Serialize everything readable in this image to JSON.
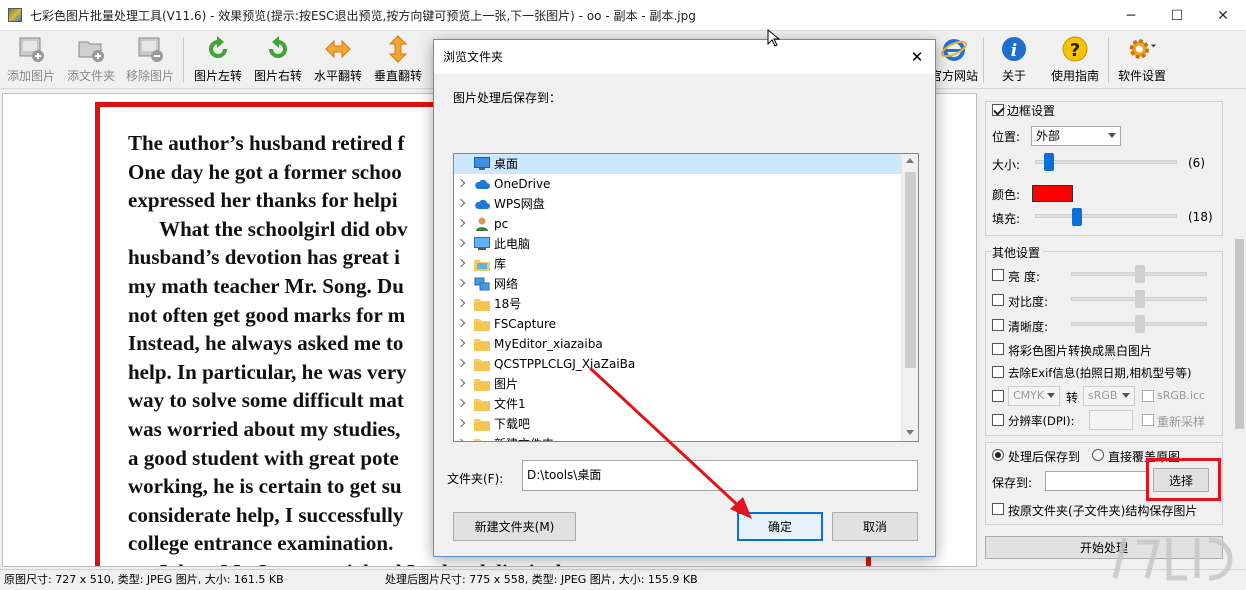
{
  "window": {
    "title": "七彩色图片批量处理工具(V11.6) - 效果预览(提示:按ESC退出预览,按方向键可预览上一张,下一张图片) - oo - 副本 - 副本.jpg",
    "minimize": "─",
    "maximize": "☐",
    "close": "✕"
  },
  "toolbar": {
    "add_image": "添加图片",
    "add_folder": "添文件夹",
    "remove_image": "移除图片",
    "rotate_left": "图片左转",
    "rotate_right": "图片右转",
    "flip_h": "水平翻转",
    "flip_v": "垂直翻转",
    "website": "官方网站",
    "about": "关于",
    "guide": "使用指南",
    "settings": "软件设置"
  },
  "preview": {
    "lines": [
      "The author’s husband retired f",
      "One day he got a former schoo",
      "expressed her thanks for helpi",
      "      What the schoolgirl did obv",
      "husband’s devotion has great i",
      "my math teacher Mr. Song. Du",
      "not often get good marks for m",
      "Instead, he always asked me to",
      "help. In particular, he was very",
      "way to solve some difficult mat",
      "was worried about my studies,",
      "a good student with great pote",
      "working, he is certain to get su",
      "considerate help, I successfully",
      "college entrance examination.",
      "      I  l       M   S               i  l    d I    d     d  li    i    h"
    ]
  },
  "border": {
    "section": "边框设置",
    "position_label": "位置:",
    "position_value": "外部",
    "size_label": "大小:",
    "size_value": "(6)",
    "size_level": 6,
    "color_label": "颜色:",
    "color": "#ff0000",
    "padding_label": "填充:",
    "padding_value": "(18)",
    "padding_level": 18
  },
  "other": {
    "section": "其他设置",
    "brightness": "亮  度:",
    "contrast": "对比度:",
    "sharpness": "清晰度:",
    "grayscale": "将彩色图片转换成黑白图片",
    "remove_exif": "去除Exif信息(拍照日期,相机型号等)",
    "colorspace_from": "CMYK",
    "convert": "转",
    "colorspace_to": "sRGB",
    "icc": "sRGB.icc",
    "dpi": "分辨率(DPI):",
    "resample": "重新采样"
  },
  "output": {
    "save_after": "处理后保存到",
    "overwrite": "直接覆盖原图",
    "save_to_label": "保存到:",
    "save_to_value": "",
    "choose": "选择",
    "keep_structure": "按原文件夹(子文件夹)结构保存图片",
    "start": "开始处理"
  },
  "status": {
    "original": "原图尺寸: 727 x 510, 类型: JPEG 图片, 大小: 161.5 KB",
    "processed": "处理后图片尺寸: 775 x 558, 类型: JPEG 图片, 大小: 155.9 KB"
  },
  "dialog": {
    "title": "浏览文件夹",
    "prompt": "图片处理后保存到：",
    "tree": [
      {
        "label": "桌面",
        "icon": "desktop-icon",
        "selected": true
      },
      {
        "label": "OneDrive",
        "icon": "cloud-icon"
      },
      {
        "label": "WPS网盘",
        "icon": "cloud-icon"
      },
      {
        "label": "pc",
        "icon": "user-icon"
      },
      {
        "label": "此电脑",
        "icon": "computer-icon"
      },
      {
        "label": "库",
        "icon": "library-icon"
      },
      {
        "label": "网络",
        "icon": "network-icon"
      },
      {
        "label": "18号",
        "icon": "folder-icon"
      },
      {
        "label": "FSCapture",
        "icon": "folder-icon"
      },
      {
        "label": "MyEditor_xiazaiba",
        "icon": "folder-icon"
      },
      {
        "label": "QCSTPPLCLGJ_XiaZaiBa",
        "icon": "folder-icon"
      },
      {
        "label": "图片",
        "icon": "folder-icon"
      },
      {
        "label": "文件1",
        "icon": "folder-icon"
      },
      {
        "label": "下载吧",
        "icon": "folder-icon"
      },
      {
        "label": "新建文件夹",
        "icon": "folder-icon"
      }
    ],
    "folder_label": "文件夹(F):",
    "folder_value": "D:\\tools\\桌面",
    "new_folder": "新建文件夹(M)",
    "ok": "确定",
    "cancel": "取消"
  }
}
